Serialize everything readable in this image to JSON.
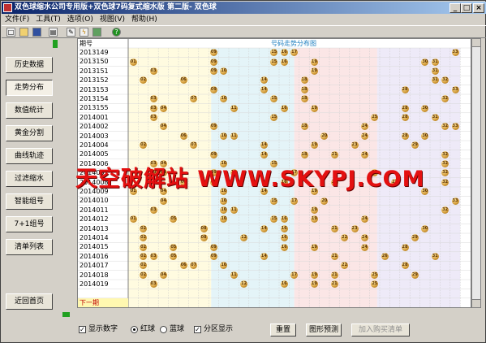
{
  "window": {
    "title": "双色球缩水公司专用版+双色球7码复式缩水版 第二版-  双色球"
  },
  "menu": [
    "文件(F)",
    "工具(T)",
    "选项(O)",
    "视图(V)",
    "帮助(H)"
  ],
  "toolbar_icons": [
    "new-icon",
    "open-icon",
    "save-icon",
    "print-icon",
    "tools-icon",
    "flash-icon",
    "calendar-icon",
    "help-icon"
  ],
  "sidebar": [
    "历史数据",
    "走势分布",
    "数值统计",
    "黄金分割",
    "曲线轨迹",
    "过滤缩水",
    "智能组号",
    "7+1组号",
    "清单列表",
    "近回首页"
  ],
  "sidebar_active": 1,
  "grid": {
    "col_period": "期号",
    "col_chart": "号码走势分布图",
    "next_label": "下一期",
    "rows": [
      {
        "p": "2013149",
        "b": [
          9,
          15,
          16,
          17,
          33
        ]
      },
      {
        "p": "2013150",
        "b": [
          1,
          9,
          15,
          16,
          19,
          30,
          31
        ]
      },
      {
        "p": "2013151",
        "b": [
          3,
          9,
          10,
          19,
          31
        ]
      },
      {
        "p": "2013152",
        "b": [
          2,
          6,
          14,
          18,
          31,
          32
        ]
      },
      {
        "p": "2013153",
        "b": [
          9,
          14,
          18,
          28,
          33
        ]
      },
      {
        "p": "2013154",
        "b": [
          3,
          7,
          10,
          15,
          18,
          32
        ]
      },
      {
        "p": "2013155",
        "b": [
          3,
          4,
          11,
          16,
          19,
          28,
          30
        ]
      },
      {
        "p": "2014001",
        "b": [
          3,
          15,
          25,
          28,
          31
        ]
      },
      {
        "p": "2014002",
        "b": [
          4,
          9,
          18,
          24,
          32,
          33
        ]
      },
      {
        "p": "2014003",
        "b": [
          6,
          10,
          11,
          20,
          24,
          28,
          30
        ]
      },
      {
        "p": "2014004",
        "b": [
          2,
          7,
          14,
          19,
          23,
          29
        ]
      },
      {
        "p": "2014005",
        "b": [
          9,
          14,
          18,
          21,
          24,
          32
        ]
      },
      {
        "p": "2014006",
        "b": [
          3,
          4,
          10,
          15,
          32
        ]
      },
      {
        "p": "2014007",
        "b": [
          3,
          4,
          9,
          11,
          17,
          25,
          32
        ]
      },
      {
        "p": "2014008",
        "b": [
          6,
          9,
          16,
          21,
          27,
          32
        ]
      },
      {
        "p": "2014009",
        "b": [
          1,
          4,
          10,
          14,
          19,
          30
        ]
      },
      {
        "p": "2014010",
        "b": [
          4,
          10,
          15,
          17,
          20,
          33
        ]
      },
      {
        "p": "2014011",
        "b": [
          3,
          10,
          11,
          19,
          32
        ]
      },
      {
        "p": "2014012",
        "b": [
          1,
          5,
          10,
          15,
          16,
          19,
          24
        ]
      },
      {
        "p": "2014013",
        "b": [
          2,
          8,
          14,
          16,
          21,
          23,
          30
        ]
      },
      {
        "p": "2014014",
        "b": [
          2,
          8,
          12,
          16,
          22,
          24,
          29
        ]
      },
      {
        "p": "2014015",
        "b": [
          2,
          5,
          9,
          16,
          19,
          24,
          28
        ]
      },
      {
        "p": "2014016",
        "b": [
          2,
          3,
          5,
          9,
          14,
          21,
          26,
          31
        ]
      },
      {
        "p": "2014017",
        "b": [
          2,
          6,
          7,
          10,
          22,
          28
        ]
      },
      {
        "p": "2014018",
        "b": [
          2,
          4,
          11,
          17,
          19,
          21,
          25,
          29
        ]
      },
      {
        "p": "2014019",
        "b": [
          3,
          12,
          16,
          19,
          21,
          25
        ]
      }
    ]
  },
  "controls": {
    "show_number_label": "显示数字",
    "red_label": "红球",
    "blue_label": "蓝球",
    "zone_label": "分区显示",
    "reset_label": "重置",
    "predict_label": "图形预测",
    "add_label": "加入购买清单"
  },
  "watermark": "天空破解站 WWW.SKYPJ.COM"
}
